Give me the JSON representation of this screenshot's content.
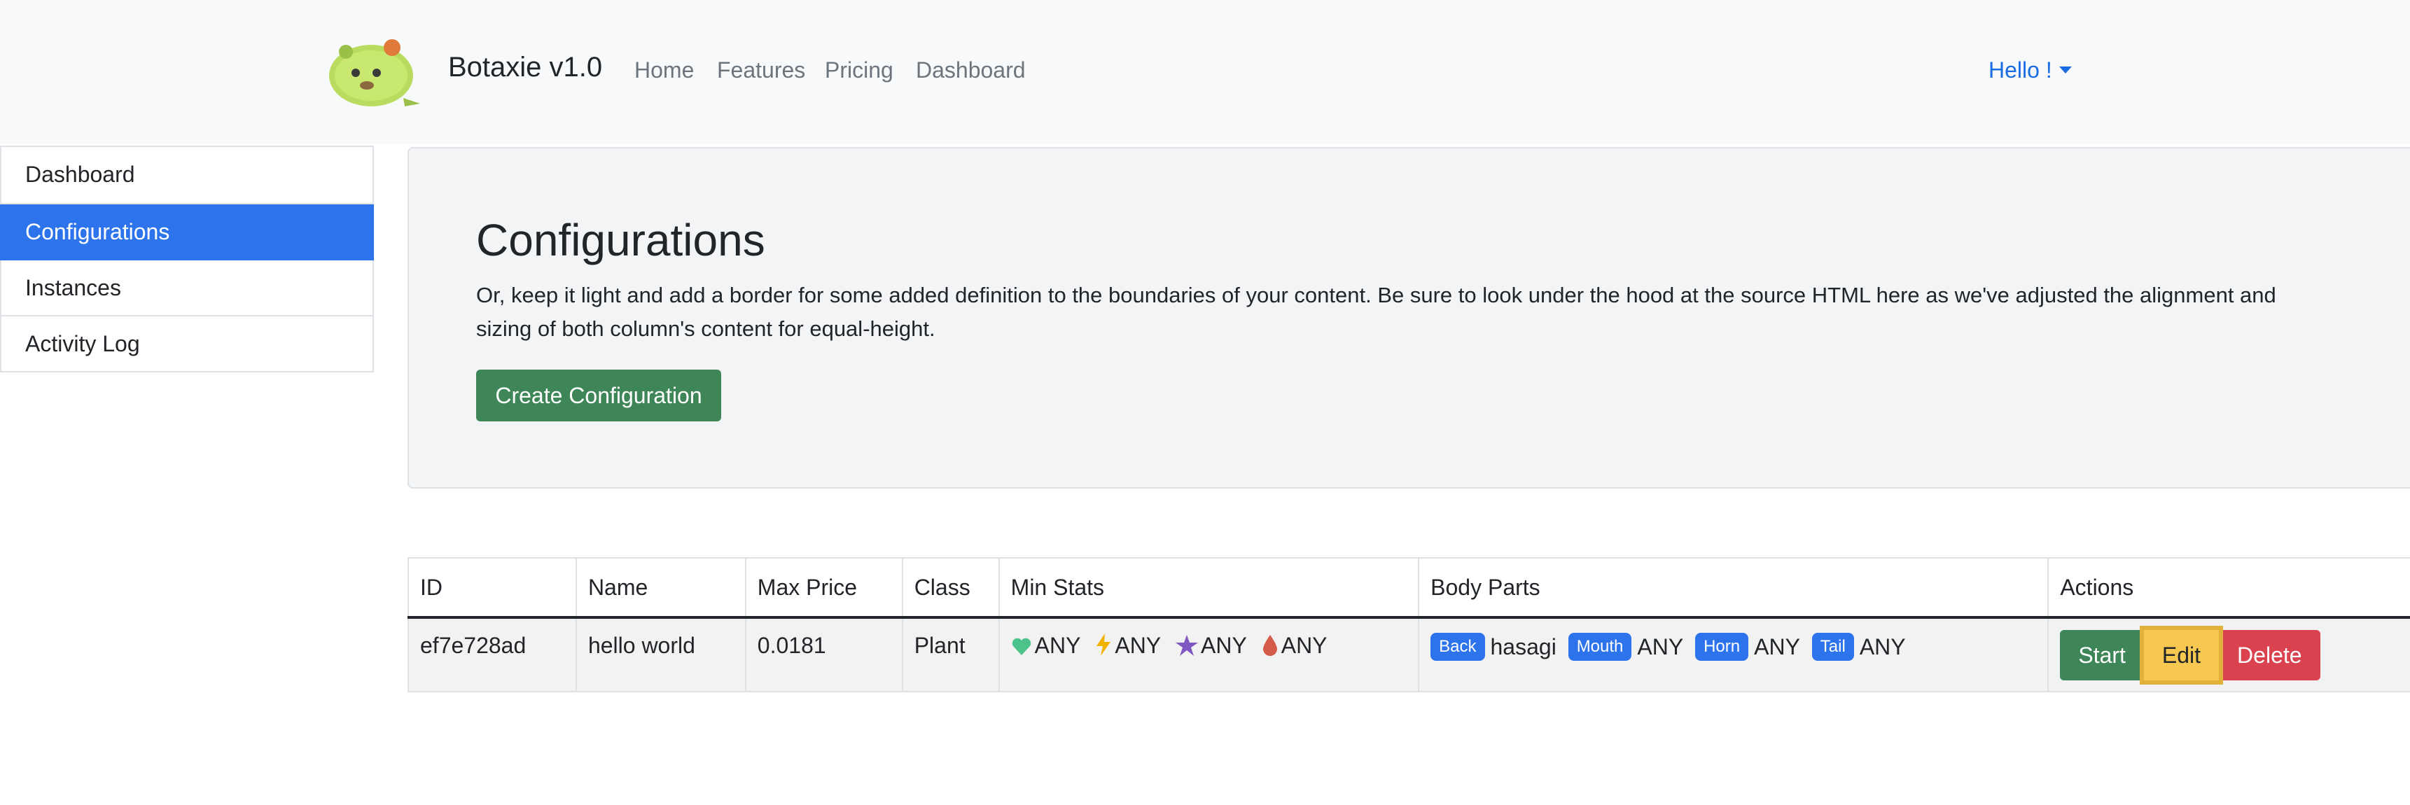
{
  "navbar": {
    "brand": "Botaxie v1.0",
    "links": [
      "Home",
      "Features",
      "Pricing",
      "Dashboard"
    ],
    "user_menu": "Hello !"
  },
  "sidebar": {
    "items": [
      {
        "label": "Dashboard",
        "active": false
      },
      {
        "label": "Configurations",
        "active": true
      },
      {
        "label": "Instances",
        "active": false
      },
      {
        "label": "Activity Log",
        "active": false
      }
    ]
  },
  "jumbotron": {
    "title": "Configurations",
    "description": "Or, keep it light and add a border for some added definition to the boundaries of your content. Be sure to look under the hood at the source HTML here as we've adjusted the alignment and sizing of both column's content for equal-height.",
    "create_button": "Create Configuration"
  },
  "table": {
    "headers": [
      "ID",
      "Name",
      "Max Price",
      "Class",
      "Min Stats",
      "Body Parts",
      "Actions"
    ],
    "rows": [
      {
        "id": "ef7e728ad",
        "name": "hello world",
        "max_price": "0.0181",
        "class": "Plant",
        "min_stats": [
          {
            "icon": "heart-icon",
            "value": "ANY"
          },
          {
            "icon": "lightning-icon",
            "value": "ANY"
          },
          {
            "icon": "star-icon",
            "value": "ANY"
          },
          {
            "icon": "drop-icon",
            "value": "ANY"
          }
        ],
        "body_parts": [
          {
            "part": "Back",
            "value": "hasagi"
          },
          {
            "part": "Mouth",
            "value": "ANY"
          },
          {
            "part": "Horn",
            "value": "ANY"
          },
          {
            "part": "Tail",
            "value": "ANY"
          }
        ],
        "actions": {
          "start": "Start",
          "edit": "Edit",
          "delete": "Delete"
        }
      }
    ]
  },
  "colors": {
    "primary": "#2d74ec",
    "success": "#3e8657",
    "warning": "#f6c84f",
    "danger": "#d9424e"
  }
}
